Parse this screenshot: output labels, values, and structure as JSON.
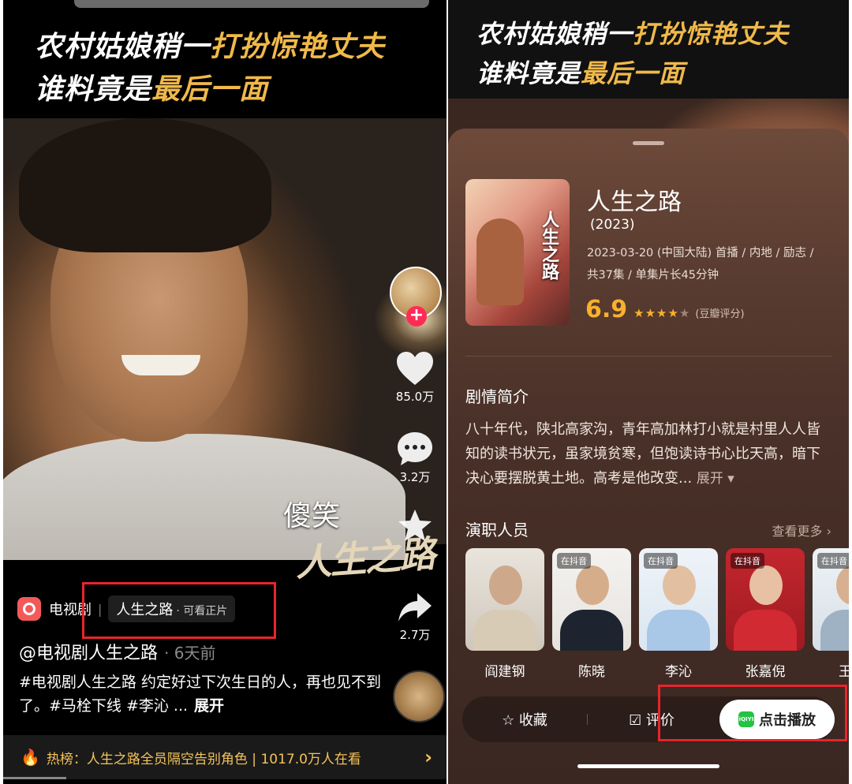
{
  "left": {
    "banner": {
      "line1_plain": "农村姑娘稍一",
      "line1_gold": "打扮惊艳丈夫",
      "line2_plain": "谁料竟是",
      "line2_gold": "最后一面"
    },
    "subtitle_caption": "傻笑",
    "title_watermark": "人生之路",
    "side_actions": {
      "likes": "85.0万",
      "comments": "3.2万",
      "shares": "2.7万"
    },
    "tag": {
      "category": "电视剧",
      "title": "人生之路",
      "subtext": "· 可看正片"
    },
    "author": {
      "handle": "@电视剧人生之路",
      "time": "· 6天前"
    },
    "description": {
      "text": "#电视剧人生之路 约定好过下次生日的人，再也见不到了。#马栓下线 #李沁 ...",
      "expand_label": "展开"
    },
    "hot": {
      "label": "热榜：人生之路全员隔空告别角色 | 1017.0万人在看",
      "arrow": "›"
    }
  },
  "right": {
    "banner": {
      "line1_plain": "农村姑娘稍一",
      "line1_gold": "打扮惊艳丈夫",
      "line2_plain": "谁料竟是",
      "line2_gold": "最后一面"
    },
    "poster_text": "人生之路",
    "info": {
      "title": "人生之路",
      "year": "(2023)",
      "meta_line1": "2023-03-20 (中国大陆) 首播 / 内地 / 励志 /",
      "meta_line2": "共37集 / 单集片长45分钟",
      "rating": "6.9",
      "rating_stars": 3.5,
      "rating_source": "(豆瓣评分)"
    },
    "synopsis": {
      "title": "剧情简介",
      "text": "八十年代，陕北高家沟，青年高加林打小就是村里人人皆知的读书状元，虽家境贫寒，但饱读诗书心比天高，暗下决心要摆脱黄土地。高考是他改变...",
      "more": "展开 ▾"
    },
    "cast": {
      "title": "演职人员",
      "see_more": "查看更多 ›",
      "members": [
        {
          "name": "阎建钢",
          "badge": ""
        },
        {
          "name": "陈晓",
          "badge": "在抖音"
        },
        {
          "name": "李沁",
          "badge": "在抖音"
        },
        {
          "name": "张嘉倪",
          "badge": "在抖音"
        },
        {
          "name": "王子",
          "badge": "在抖音"
        }
      ]
    },
    "actions": {
      "favorite": "☆ 收藏",
      "review": "☑ 评价",
      "play": "点击播放",
      "play_brand": "iQIYI"
    }
  },
  "colors": {
    "gold": "#f0b94a",
    "accent_red": "#fe2c55",
    "highlight_box": "#e8242c",
    "rating": "#f7b12d"
  }
}
